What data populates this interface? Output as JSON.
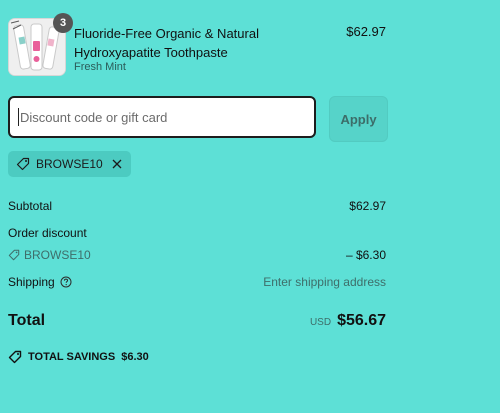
{
  "product": {
    "quantity": "3",
    "title": "Fluoride-Free Organic & Natural Hydroxyapatite Toothpaste",
    "variant": "Fresh Mint",
    "price": "$62.97"
  },
  "discount": {
    "placeholder": "Discount code or gift card",
    "apply_label": "Apply",
    "applied_code": "BROWSE10"
  },
  "summary": {
    "subtotal_label": "Subtotal",
    "subtotal_value": "$62.97",
    "order_discount_label": "Order discount",
    "discount_code": "BROWSE10",
    "discount_value": "– $6.30",
    "shipping_label": "Shipping",
    "shipping_value": "Enter shipping address",
    "total_label": "Total",
    "currency": "USD",
    "total_value": "$56.67",
    "savings_label": "TOTAL SAVINGS",
    "savings_value": "$6.30"
  },
  "icons": {
    "tag": "tag-icon",
    "close": "close-icon",
    "help": "help-circle-icon",
    "thumbnail": "toothpaste-product-image"
  },
  "colors": {
    "background": "#5de0d6",
    "chip": "#4ccbc1",
    "badge": "#555555"
  }
}
